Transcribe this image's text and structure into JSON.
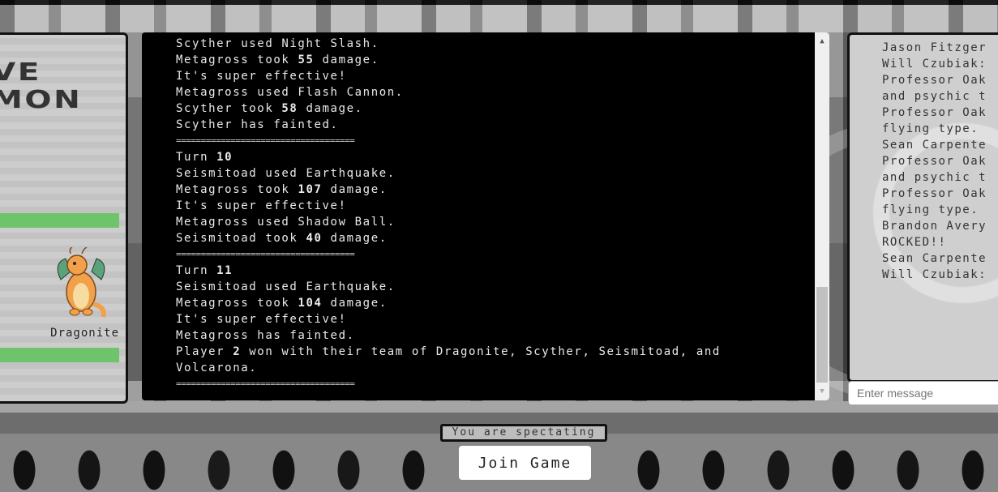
{
  "left_panel": {
    "title_line1": "VE",
    "title_line2": "MON",
    "pokemon_name": "Dragonite",
    "hp_color": "#6fc46b"
  },
  "battle_log": {
    "lines": [
      {
        "text": "Scyther used Night Slash."
      },
      {
        "pre": "Metagross took ",
        "num": "55",
        "post": " damage."
      },
      {
        "text": "It's super effective!"
      },
      {
        "text": "Metagross used Flash Cannon."
      },
      {
        "pre": "Scyther took ",
        "num": "58",
        "post": " damage."
      },
      {
        "text": "Scyther has fainted."
      },
      {
        "sep": "===================================="
      },
      {
        "pre": "Turn ",
        "num": "10",
        "post": ""
      },
      {
        "text": "Seismitoad used Earthquake."
      },
      {
        "pre": "Metagross took ",
        "num": "107",
        "post": " damage."
      },
      {
        "text": "It's super effective!"
      },
      {
        "text": "Metagross used Shadow Ball."
      },
      {
        "pre": "Seismitoad took ",
        "num": "40",
        "post": " damage."
      },
      {
        "sep": "===================================="
      },
      {
        "pre": "Turn ",
        "num": "11",
        "post": ""
      },
      {
        "text": "Seismitoad used Earthquake."
      },
      {
        "pre": "Metagross took ",
        "num": "104",
        "post": " damage."
      },
      {
        "text": "It's super effective!"
      },
      {
        "text": "Metagross has fainted."
      },
      {
        "pre": "Player ",
        "num": "2",
        "post": " won with their team of Dragonite, Scyther, Seismitoad, and"
      },
      {
        "text": "Volcarona."
      },
      {
        "sep": "===================================="
      }
    ]
  },
  "chat": {
    "lines": [
      "Jason Fitzger",
      "Will Czubiak:",
      "Professor Oak",
      "and psychic t",
      "Professor Oak",
      "flying type.",
      "Sean Carpente",
      "Professor Oak",
      "and psychic t",
      "Professor Oak",
      "flying type.",
      "Brandon Avery",
      "ROCKED!!",
      "Sean Carpente",
      "Will Czubiak:"
    ],
    "input_placeholder": "Enter message"
  },
  "status": {
    "spectating_text": "You are spectating"
  },
  "join_button_label": "Join Game"
}
